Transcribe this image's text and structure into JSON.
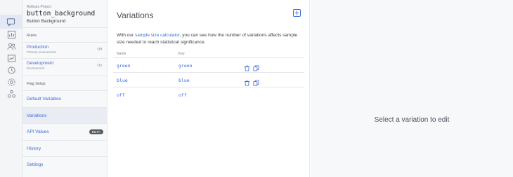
{
  "rail": {
    "items": [
      {
        "name": "flags-icon",
        "active": true
      },
      {
        "name": "analytics-icon",
        "active": false
      },
      {
        "name": "users-icon",
        "active": false
      },
      {
        "name": "experiments-icon",
        "active": false
      },
      {
        "name": "history-icon",
        "active": false
      },
      {
        "name": "settings-icon",
        "active": false
      },
      {
        "name": "integrations-icon",
        "active": false
      }
    ]
  },
  "sidebar": {
    "project": "Rollouts Project",
    "flag_key": "button_background",
    "flag_name": "Button Background",
    "rules_label": "Rules",
    "environments": [
      {
        "name": "Production",
        "subtitle": "Primary environment",
        "state": "Off"
      },
      {
        "name": "Development",
        "subtitle": "Environment",
        "state": "On"
      }
    ],
    "flag_setup_label": "Flag Setup",
    "nav": [
      {
        "label": "Default Variables",
        "badge": ""
      },
      {
        "label": "Variations",
        "badge": ""
      },
      {
        "label": "API Values",
        "badge": "BETA"
      },
      {
        "label": "History",
        "badge": ""
      },
      {
        "label": "Settings",
        "badge": ""
      }
    ]
  },
  "main": {
    "title": "Variations",
    "intro_prefix": "With our ",
    "intro_link": "sample size calculator",
    "intro_suffix": ", you can see how the number of variations affects sample size needed to reach statistical significance.",
    "columns": {
      "name": "Name",
      "key": "Key"
    },
    "rows": [
      {
        "name": "green",
        "key": "green"
      },
      {
        "name": "blue",
        "key": "blue"
      },
      {
        "name": "off",
        "key": "off"
      }
    ]
  },
  "right": {
    "empty_text": "Select a variation to edit"
  },
  "colors": {
    "accent": "#3c6bd6",
    "rail_active": "#e3e8f7",
    "nav_active": "#e9ecf2"
  }
}
